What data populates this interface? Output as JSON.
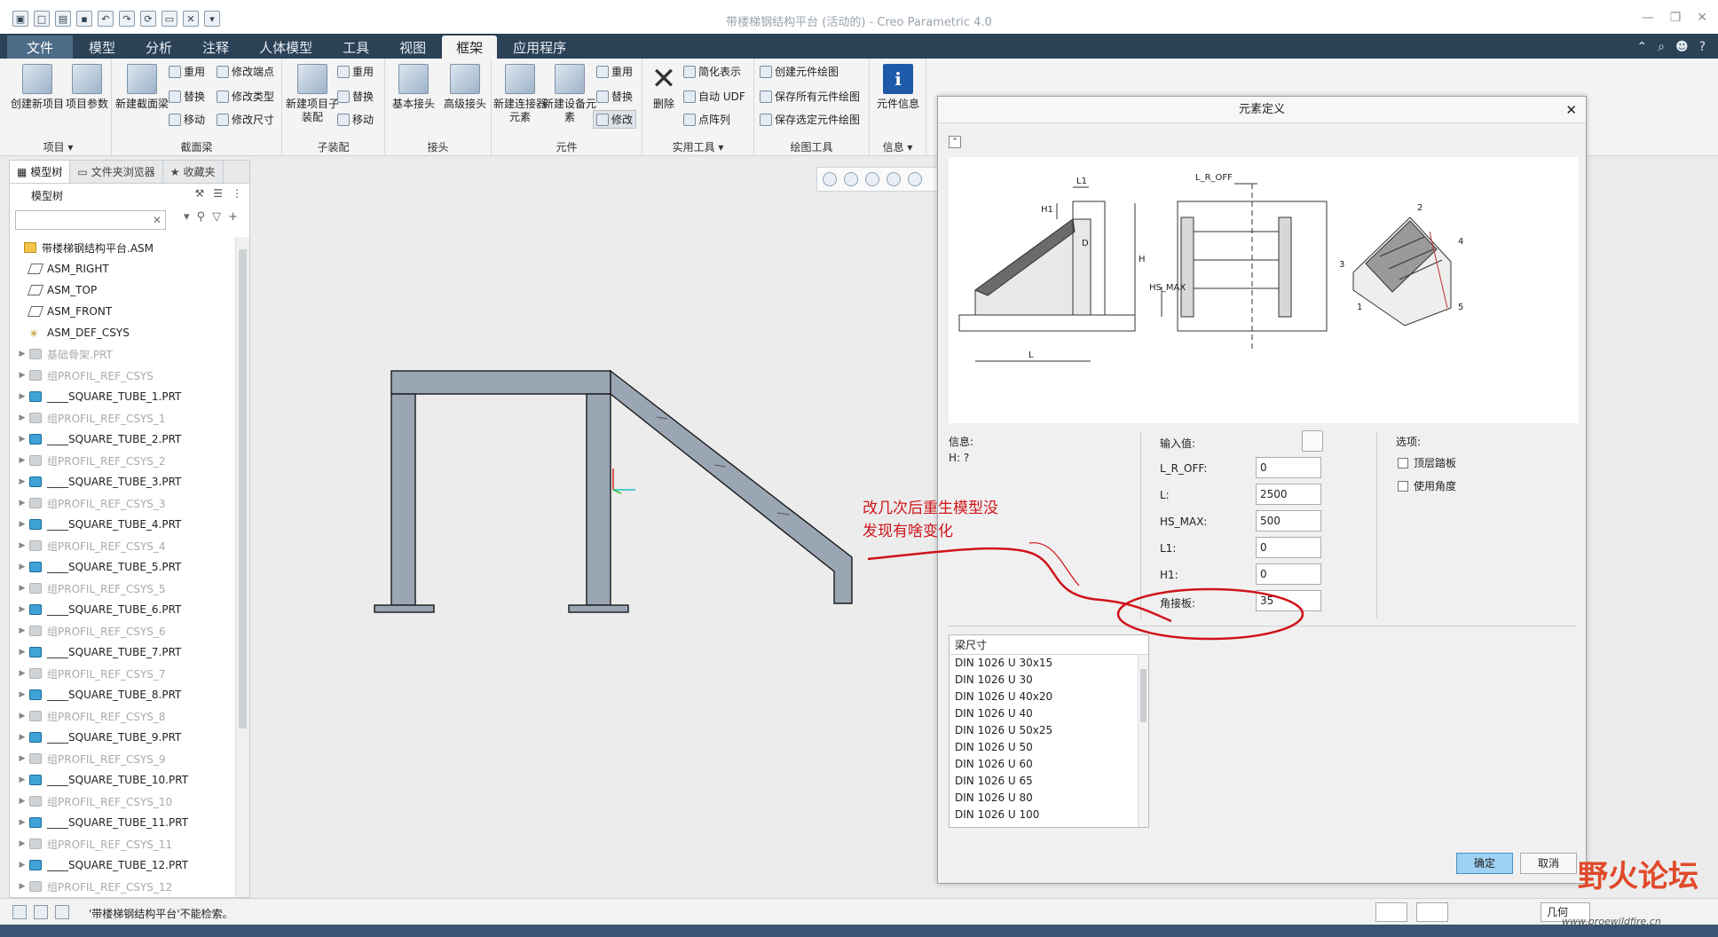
{
  "window": {
    "title": "带楼梯钢结构平台 (活动的) - Creo Parametric 4.0"
  },
  "menu": {
    "tabs": [
      "文件",
      "模型",
      "分析",
      "注释",
      "人体模型",
      "工具",
      "视图",
      "框架",
      "应用程序"
    ],
    "active_tab": "框架"
  },
  "ribbon": {
    "groups": {
      "project": {
        "caption": "项目 ▾",
        "create_label": "创建新项目",
        "params_label": "项目参数"
      },
      "beam": {
        "caption": "截面梁",
        "new_label": "新建截面梁",
        "reuse": "重用",
        "replace": "替换",
        "move": "移动",
        "mod_end": "修改端点",
        "mod_type": "修改类型",
        "mod_size": "修改尺寸"
      },
      "subasm": {
        "caption": "子装配",
        "new_label": "新建项目子装配",
        "reuse": "重用",
        "replace": "替换",
        "move": "移动"
      },
      "joint": {
        "caption": "接头",
        "basic_label": "基本接头",
        "advanced_label": "高级接头"
      },
      "element": {
        "caption": "元件",
        "new_conn_label": "新建连接器元素",
        "new_equip_label": "新建设备元素",
        "reuse": "重用",
        "replace": "替换",
        "modify": "修改"
      },
      "util": {
        "caption": "实用工具 ▾",
        "delete_label": "删除",
        "simplify": "简化表示",
        "auto_udf": "自动 UDF",
        "pattern": "点阵列"
      },
      "drawing": {
        "caption": "绘图工具",
        "create": "创建元件绘图",
        "save_all": "保存所有元件绘图",
        "save_sel": "保存选定元件绘图"
      },
      "info": {
        "caption": "信息 ▾",
        "elem_info_label": "元件信息"
      }
    }
  },
  "panel": {
    "tabs": [
      "模型树",
      "文件夹浏览器",
      "收藏夹"
    ],
    "tree_label": "模型树",
    "root": "带楼梯钢结构平台.ASM",
    "items": [
      {
        "label": "ASM_RIGHT",
        "kind": "plane",
        "dim": false
      },
      {
        "label": "ASM_TOP",
        "kind": "plane",
        "dim": false
      },
      {
        "label": "ASM_FRONT",
        "kind": "plane",
        "dim": false
      },
      {
        "label": "ASM_DEF_CSYS",
        "kind": "csys",
        "dim": false
      },
      {
        "label": "基础骨架.PRT",
        "kind": "gpart",
        "dim": true
      },
      {
        "label": "组PROFIL_REF_CSYS",
        "kind": "gpart",
        "dim": true
      },
      {
        "label": "____SQUARE_TUBE_1.PRT",
        "kind": "part",
        "dim": false
      },
      {
        "label": "组PROFIL_REF_CSYS_1",
        "kind": "gpart",
        "dim": true
      },
      {
        "label": "____SQUARE_TUBE_2.PRT",
        "kind": "part",
        "dim": false
      },
      {
        "label": "组PROFIL_REF_CSYS_2",
        "kind": "gpart",
        "dim": true
      },
      {
        "label": "____SQUARE_TUBE_3.PRT",
        "kind": "part",
        "dim": false
      },
      {
        "label": "组PROFIL_REF_CSYS_3",
        "kind": "gpart",
        "dim": true
      },
      {
        "label": "____SQUARE_TUBE_4.PRT",
        "kind": "part",
        "dim": false
      },
      {
        "label": "组PROFIL_REF_CSYS_4",
        "kind": "gpart",
        "dim": true
      },
      {
        "label": "____SQUARE_TUBE_5.PRT",
        "kind": "part",
        "dim": false
      },
      {
        "label": "组PROFIL_REF_CSYS_5",
        "kind": "gpart",
        "dim": true
      },
      {
        "label": "____SQUARE_TUBE_6.PRT",
        "kind": "part",
        "dim": false
      },
      {
        "label": "组PROFIL_REF_CSYS_6",
        "kind": "gpart",
        "dim": true
      },
      {
        "label": "____SQUARE_TUBE_7.PRT",
        "kind": "part",
        "dim": false
      },
      {
        "label": "组PROFIL_REF_CSYS_7",
        "kind": "gpart",
        "dim": true
      },
      {
        "label": "____SQUARE_TUBE_8.PRT",
        "kind": "part",
        "dim": false
      },
      {
        "label": "组PROFIL_REF_CSYS_8",
        "kind": "gpart",
        "dim": true
      },
      {
        "label": "____SQUARE_TUBE_9.PRT",
        "kind": "part",
        "dim": false
      },
      {
        "label": "组PROFIL_REF_CSYS_9",
        "kind": "gpart",
        "dim": true
      },
      {
        "label": "____SQUARE_TUBE_10.PRT",
        "kind": "part",
        "dim": false
      },
      {
        "label": "组PROFIL_REF_CSYS_10",
        "kind": "gpart",
        "dim": true
      },
      {
        "label": "____SQUARE_TUBE_11.PRT",
        "kind": "part",
        "dim": false
      },
      {
        "label": "组PROFIL_REF_CSYS_11",
        "kind": "gpart",
        "dim": true
      },
      {
        "label": "____SQUARE_TUBE_12.PRT",
        "kind": "part",
        "dim": false
      },
      {
        "label": "组PROFIL_REF_CSYS_12",
        "kind": "gpart",
        "dim": true
      }
    ]
  },
  "dialog": {
    "title": "元素定义",
    "figure_labels": {
      "l1": "L1",
      "h1": "H1",
      "h": "H",
      "l": "L",
      "d": "D",
      "lroff": "L_R_OFF",
      "hsmax": "HS_MAX",
      "n1": "1",
      "n2": "2",
      "n3": "3",
      "n4": "4",
      "n5": "5"
    },
    "info_label": "信息:",
    "info_value": "H: ?",
    "input_label": "输入值:",
    "params": [
      {
        "name": "L_R_OFF:",
        "value": "0"
      },
      {
        "name": "L:",
        "value": "2500"
      },
      {
        "name": "HS_MAX:",
        "value": "500"
      },
      {
        "name": "L1:",
        "value": "0"
      },
      {
        "name": "H1:",
        "value": "0"
      },
      {
        "name": "角接板:",
        "value": "35"
      }
    ],
    "options_label": "选项:",
    "options": [
      "顶层踏板",
      "使用角度"
    ],
    "beam_list_header": "梁尺寸",
    "beam_sizes": [
      "DIN 1026 U 30x15",
      "DIN 1026 U 30",
      "DIN 1026 U 40x20",
      "DIN 1026 U 40",
      "DIN 1026 U 50x25",
      "DIN 1026 U 50",
      "DIN 1026 U 60",
      "DIN 1026 U 65",
      "DIN 1026 U 80",
      "DIN 1026 U 100"
    ],
    "ok_label": "确定",
    "cancel_label": "取消"
  },
  "annotation": {
    "line1": "改几次后重生模型没",
    "line2": "发现有啥变化"
  },
  "status": {
    "message": "'带楼梯钢结构平台'不能检索。",
    "filter": "几何"
  },
  "watermark": {
    "text": "野火论坛",
    "url": "www.proewildfire.cn"
  },
  "colors": {
    "menubar": "#2b4156",
    "annotation": "#d0141a",
    "ok_button": "#9ed1f3",
    "beam_fill": "#9aa6b4"
  }
}
